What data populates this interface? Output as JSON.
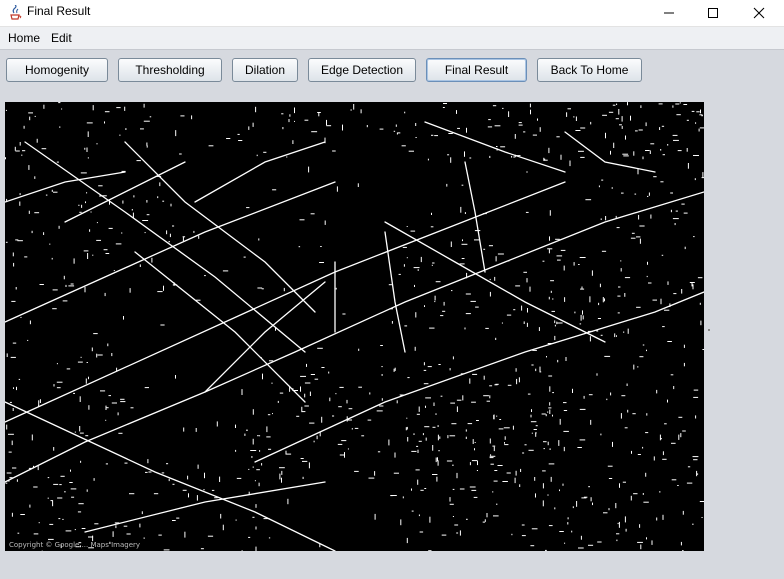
{
  "window": {
    "title": "Final Result",
    "controls": [
      "minimize",
      "maximize",
      "close"
    ]
  },
  "menu": {
    "items": [
      "Home",
      "Edit"
    ]
  },
  "toolbar": {
    "buttons": [
      "Homogenity",
      "Thresholding",
      "Dilation",
      "Edge Detection",
      "Final Result",
      "Back To Home"
    ],
    "active": "Final Result"
  },
  "image": {
    "watermark": "Copyright © Google ... Maps Imagery",
    "colors": {
      "background": "#000000",
      "edges": "#ffffff"
    }
  },
  "icons": {
    "app": "java-coffee-icon",
    "minimize": "minimize-icon",
    "maximize": "maximize-icon",
    "close": "close-icon"
  }
}
